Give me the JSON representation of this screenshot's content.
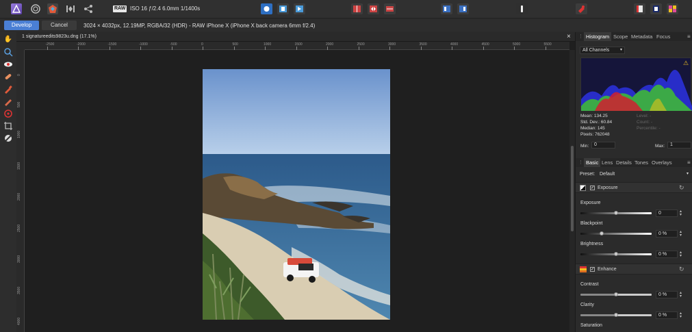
{
  "toolbar": {
    "raw_badge": "RAW",
    "exif": "ISO 16 ƒ/2.4 6.0mm 1/1400s"
  },
  "context": {
    "develop_label": "Develop",
    "cancel_label": "Cancel",
    "image_info": "3024 × 4032px, 12.19MP, RGBA/32 (HDR) - RAW",
    "camera_info": "iPhone X (iPhone X back camera 6mm f/2.4)"
  },
  "document": {
    "tab_title": "1 signatureedits9823u.dng (17.1%)",
    "close_glyph": "×",
    "ruler_h": [
      "-2500",
      "-2000",
      "-1500",
      "-1000",
      "-500",
      "0",
      "500",
      "1000",
      "1500",
      "2000",
      "2500",
      "3000",
      "3500",
      "4000",
      "4500",
      "5000",
      "5500"
    ],
    "ruler_v": [
      "0",
      "500",
      "1000",
      "1500",
      "2000",
      "2500",
      "3000",
      "3500",
      "4000"
    ],
    "ruler_unit": "px"
  },
  "histogram_panel": {
    "tabs": [
      "Histogram",
      "Scope",
      "Metadata",
      "Focus"
    ],
    "channel": "All Channels",
    "mean": "Mean: 134.25",
    "std_dev": "Std. Dev.: 60.84",
    "median": "Median: 145",
    "pixels": "Pixels: 762048",
    "level": "Level: -",
    "count": "Count: -",
    "percentile": "Percentile: -",
    "min_label": "Min:",
    "min_value": "0",
    "max_label": "Max:",
    "max_value": "1",
    "warning_icon_color": "#f0c020"
  },
  "basic_panel": {
    "tabs": [
      "Basic",
      "Lens",
      "Details",
      "Tones",
      "Overlays"
    ],
    "preset_label": "Preset:",
    "preset_value": "Default",
    "exposure_section": "Exposure",
    "enhance_section": "Enhance",
    "sliders": {
      "exposure": {
        "label": "Exposure",
        "value": "0",
        "level": 0.5
      },
      "blackpoint": {
        "label": "Blackpoint",
        "value": "0 %",
        "level": 0.3
      },
      "brightness": {
        "label": "Brightness",
        "value": "0 %",
        "level": 0.5
      },
      "contrast": {
        "label": "Contrast",
        "value": "0 %",
        "level": 0.5
      },
      "clarity": {
        "label": "Clarity",
        "value": "0 %",
        "level": 0.5
      }
    },
    "saturation_label": "Saturation"
  },
  "colors": {
    "accent": "#4a7fd4",
    "panel_bg": "#2b2b2b",
    "canvas_bg": "#1f1f1f"
  }
}
